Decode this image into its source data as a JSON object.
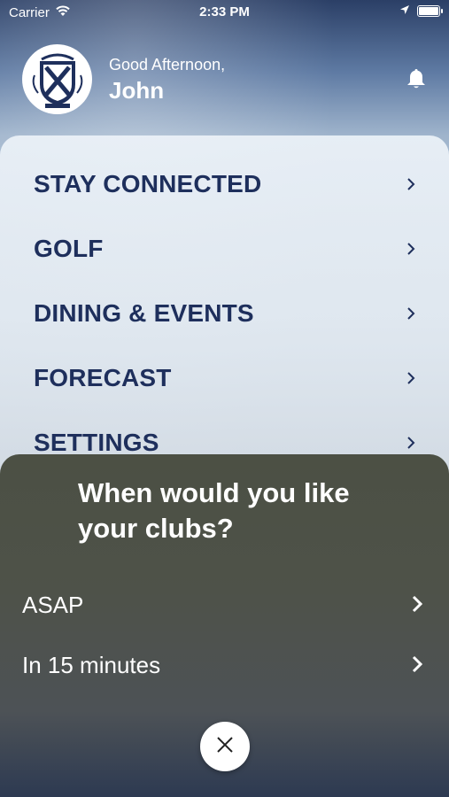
{
  "status_bar": {
    "carrier": "Carrier",
    "time": "2:33 PM"
  },
  "header": {
    "greeting": "Good Afternoon,",
    "user_name": "John"
  },
  "menu": {
    "items": [
      {
        "label": "STAY CONNECTED"
      },
      {
        "label": "GOLF"
      },
      {
        "label": "DINING & EVENTS"
      },
      {
        "label": "FORECAST"
      },
      {
        "label": "SETTINGS"
      }
    ]
  },
  "sheet": {
    "title": "When would you like your clubs?",
    "options": [
      {
        "label": "ASAP"
      },
      {
        "label": "In 15 minutes"
      }
    ]
  },
  "icons": {
    "status": [
      "wifi-icon",
      "location-arrow-icon",
      "battery-icon"
    ],
    "header": [
      "club-crest-logo",
      "bell-icon"
    ],
    "navigation": [
      "chevron-right-icon",
      "close-icon"
    ]
  },
  "colors": {
    "menu_text": "#1e2f5c",
    "sheet_background": "#4e5249",
    "white": "#ffffff"
  }
}
